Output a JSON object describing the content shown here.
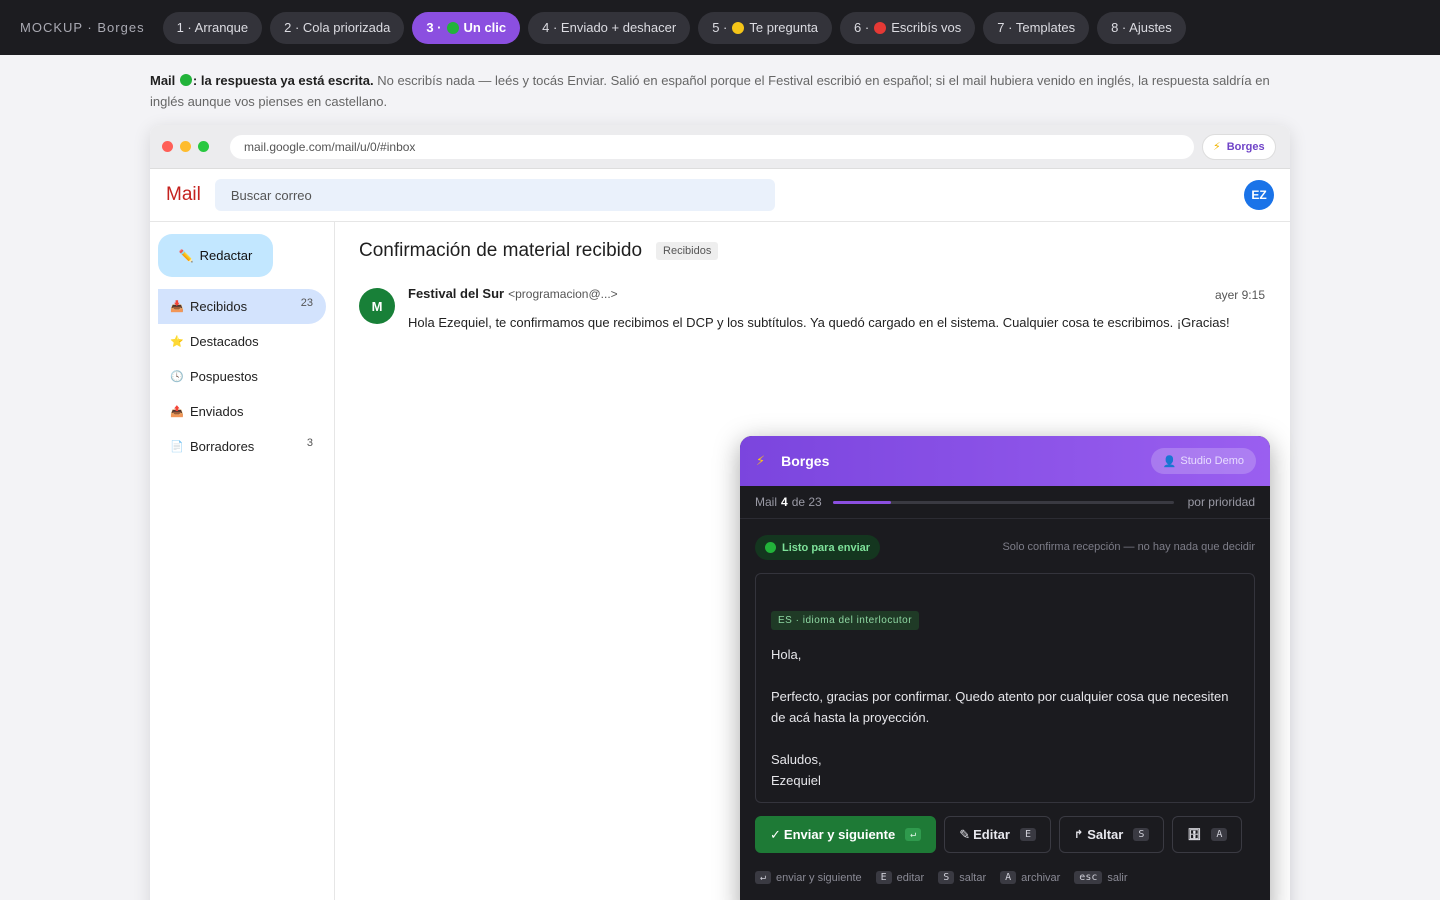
{
  "topbar": {
    "brand": "MOCKUP · Borges",
    "tabs": [
      {
        "label": "1 · Arranque"
      },
      {
        "label": "2 · Cola priorizada"
      },
      {
        "prefix": "3 ·",
        "label": "Un clic",
        "icon": "green-dot"
      },
      {
        "label": "4 · Enviado + deshacer"
      },
      {
        "prefix": "5 ·",
        "label": "Te pregunta",
        "icon": "yellow-dot"
      },
      {
        "prefix": "6 ·",
        "label": "Escribís vos",
        "icon": "red-dot"
      },
      {
        "label": "7 · Templates"
      },
      {
        "label": "8 · Ajustes"
      }
    ],
    "active_tab": 2
  },
  "intro": {
    "lead_a": "Mail",
    "lead_b": ": la respuesta ya está escrita.",
    "text": "No escribís nada — leés y tocás Enviar. Salió en español porque el Festival escribió en español; si el mail hubiera venido en inglés, la respuesta saldría en inglés aunque vos pienses en castellano."
  },
  "browser": {
    "url": "mail.google.com/mail/u/0/#inbox",
    "extension_label": "Borges"
  },
  "mail": {
    "logo": "Mail",
    "search_placeholder": "Buscar correo",
    "avatar_initials": "EZ",
    "compose_label": "Redactar",
    "nav": [
      {
        "label": "Recibidos",
        "count": "23",
        "icon": "inbox-icon"
      },
      {
        "label": "Destacados",
        "count": "",
        "icon": "star-icon"
      },
      {
        "label": "Pospuestos",
        "count": "",
        "icon": "clock-icon"
      },
      {
        "label": "Enviados",
        "count": "",
        "icon": "sent-icon"
      },
      {
        "label": "Borradores",
        "count": "3",
        "icon": "draft-icon"
      }
    ],
    "subject": "Confirmación de material recibido",
    "subject_tag": "Recibidos",
    "message": {
      "avatar": "M",
      "sender_name": "Festival del Sur",
      "sender_email": "<programacion@...>",
      "time": "ayer 9:15",
      "body": "Hola Ezequiel, te confirmamos que recibimos el DCP y los subtítulos. Ya quedó cargado en el sistema. Cualquier cosa te escribimos. ¡Gracias!"
    }
  },
  "panel": {
    "title": "Borges",
    "studio": "Studio Demo",
    "progress_prefix": "Mail",
    "progress_current": "4",
    "progress_suffix": "de 23",
    "progress_fraction": 0.17,
    "order": "por prioridad",
    "status": "Listo para enviar",
    "status_note": "Solo confirma recepción — no hay nada que decidir",
    "lang_tag": "ES · idioma del interlocutor",
    "draft": {
      "greeting": "Hola,",
      "body": "Perfecto, gracias por confirmar. Quedo atento por cualquier cosa que necesiten de acá hasta la proyección.",
      "closing": "Saludos,",
      "signature": "Ezequiel"
    },
    "buttons": {
      "send": "Enviar y siguiente",
      "send_key": "↵",
      "edit": "Editar",
      "edit_key": "E",
      "skip": "Saltar",
      "skip_key": "S",
      "archive_key": "A"
    },
    "hints": [
      {
        "key": "↵",
        "label": "enviar y siguiente"
      },
      {
        "key": "E",
        "label": "editar"
      },
      {
        "key": "S",
        "label": "saltar"
      },
      {
        "key": "A",
        "label": "archivar"
      },
      {
        "key": "esc",
        "label": "salir"
      }
    ]
  },
  "colors": {
    "accent": "#8b4fe0",
    "send_green": "#1e7a36",
    "panel_bg": "#1b1b1f"
  }
}
